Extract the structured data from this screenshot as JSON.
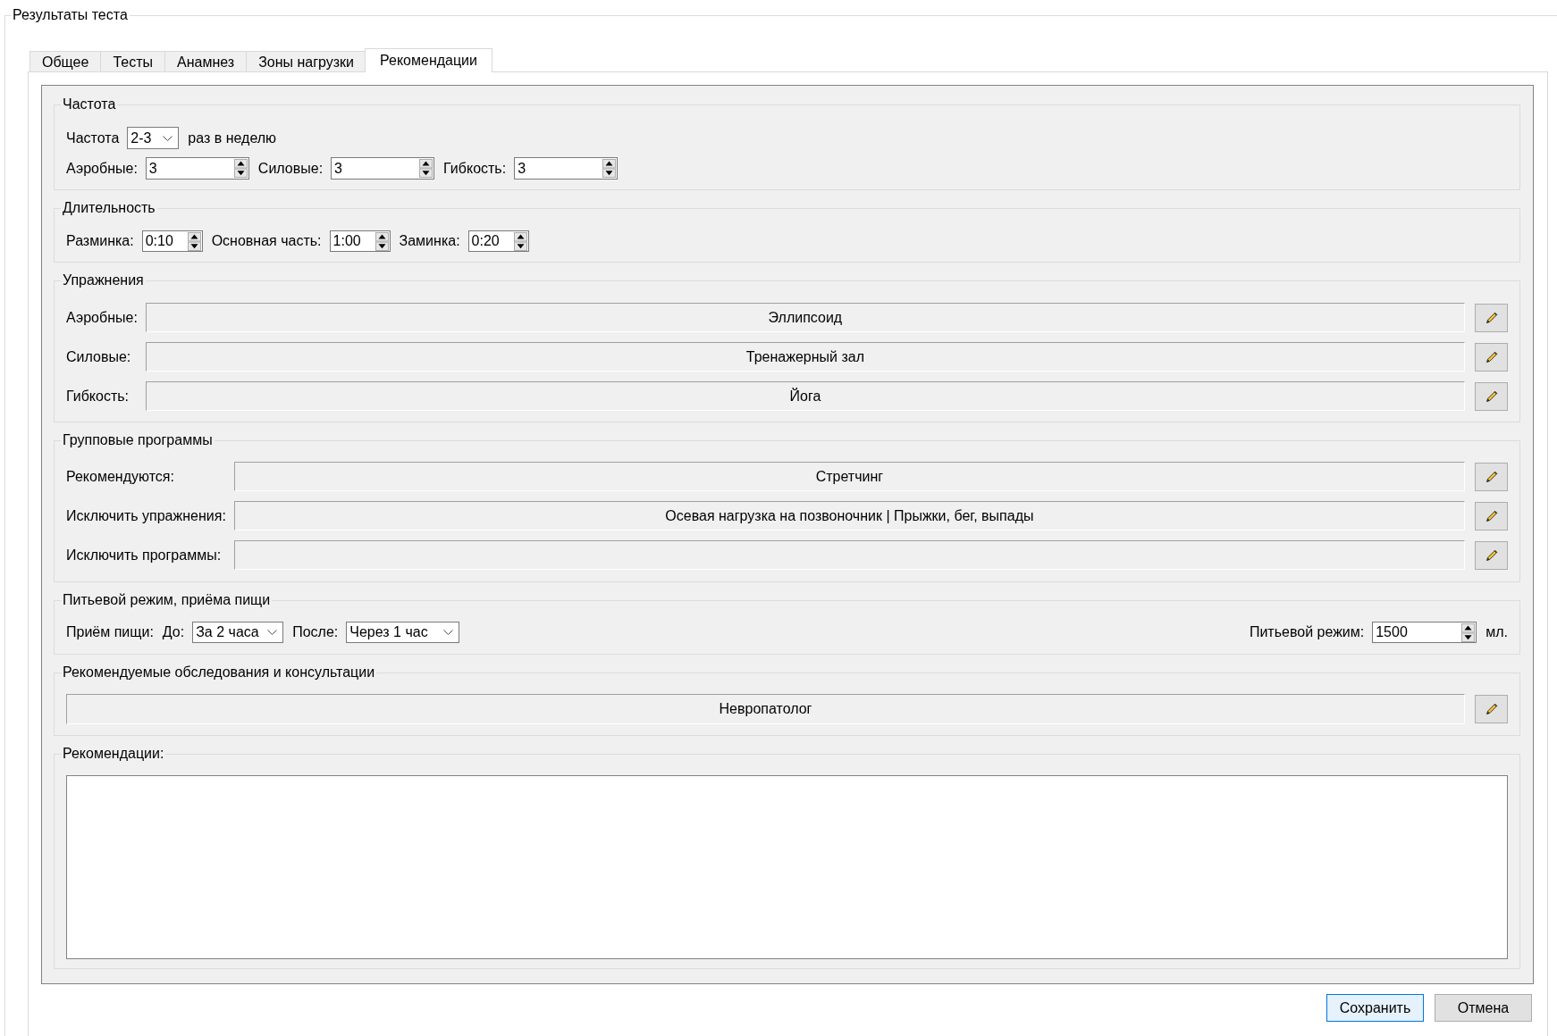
{
  "window": {
    "title": "Результаты теста"
  },
  "tabs": [
    {
      "label": "Общее",
      "selected": false
    },
    {
      "label": "Тесты",
      "selected": false
    },
    {
      "label": "Анамнез",
      "selected": false
    },
    {
      "label": "Зоны нагрузки",
      "selected": false
    },
    {
      "label": "Рекомендации",
      "selected": true
    }
  ],
  "frequency": {
    "title": "Частота",
    "label": "Частота",
    "combo": "2-3",
    "suffix": "раз в неделю",
    "spins": [
      {
        "label": "Аэробные:",
        "value": "3"
      },
      {
        "label": "Силовые:",
        "value": "3"
      },
      {
        "label": "Гибкость:",
        "value": "3"
      }
    ]
  },
  "duration": {
    "title": "Длительность",
    "spins": [
      {
        "label": "Разминка:",
        "value": "0:10"
      },
      {
        "label": "Основная часть:",
        "value": "1:00"
      },
      {
        "label": "Заминка:",
        "value": "0:20"
      }
    ]
  },
  "exercises": {
    "title": "Упражнения",
    "rows": [
      {
        "label": "Аэробные:",
        "value": "Эллипсоид"
      },
      {
        "label": "Силовые:",
        "value": "Тренажерный зал"
      },
      {
        "label": "Гибкость:",
        "value": "Йога"
      }
    ]
  },
  "group_programs": {
    "title": "Групповые программы",
    "rows": [
      {
        "label": "Рекомендуются:",
        "value": "Стретчинг"
      },
      {
        "label": "Исключить упражнения:",
        "value": "Осевая нагрузка на позвоночник | Прыжки, бег, выпады"
      },
      {
        "label": "Исключить программы:"
      }
    ]
  },
  "nutrition": {
    "title": "Питьевой режим, приёма пищи",
    "meal_label": "Приём пищи:",
    "meal_combos": [
      {
        "label": "До:",
        "value": "За 2 часа"
      },
      {
        "label": "После:",
        "value": "Через 1 час"
      }
    ],
    "drinking": {
      "label": "Питьевой режим:",
      "value": "1500",
      "unit": "мл."
    }
  },
  "consultations": {
    "title": "Рекомендуемые обследования и консультации",
    "value": "Невропатолог"
  },
  "recommendations": {
    "title": "Рекомендации:"
  },
  "buttons": [
    {
      "label": "Сохранить",
      "default": true
    },
    {
      "label": "Отмена",
      "default": false
    }
  ]
}
